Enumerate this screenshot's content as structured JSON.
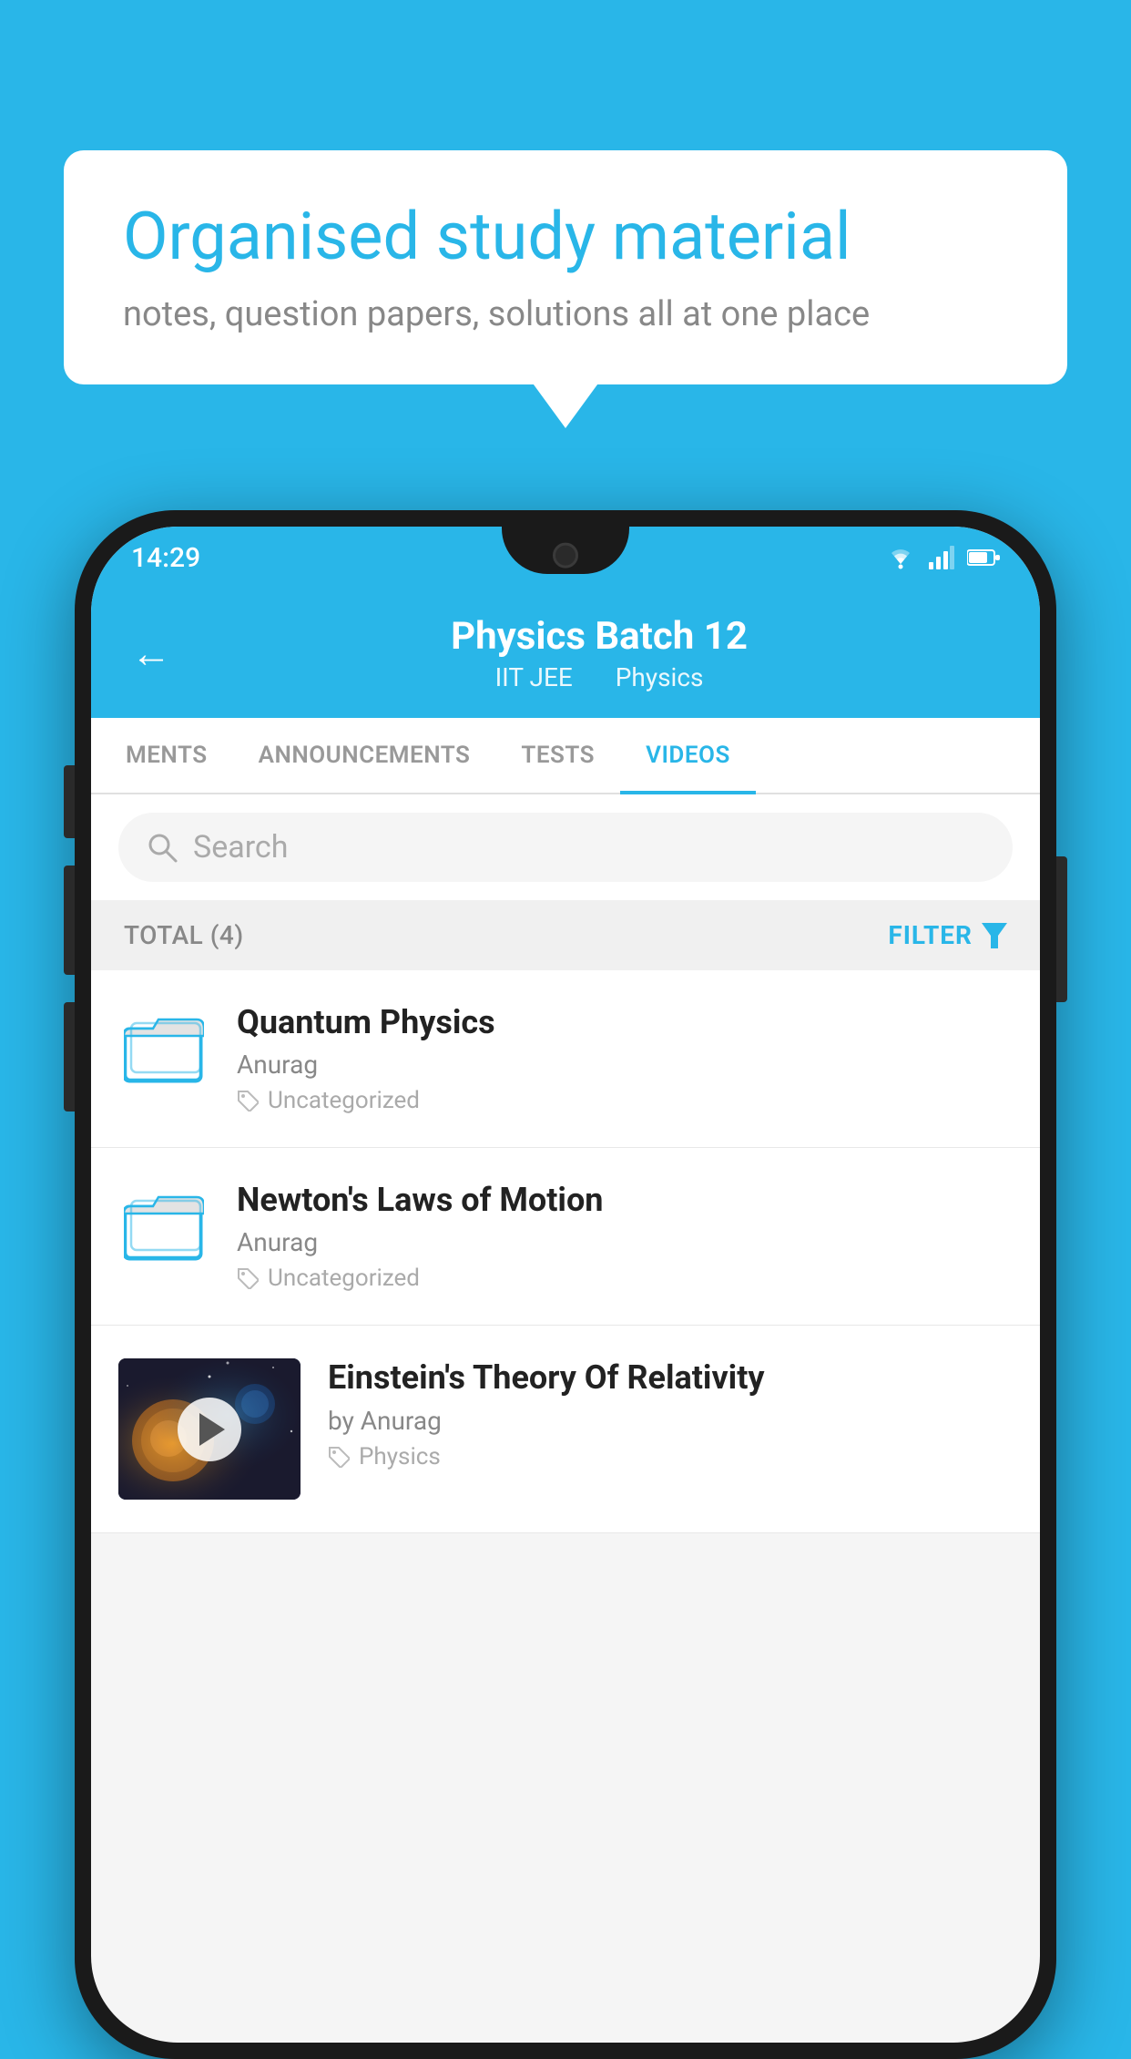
{
  "background_color": "#29b6e8",
  "speech_bubble": {
    "title": "Organised study material",
    "subtitle": "notes, question papers, solutions all at one place"
  },
  "phone": {
    "status_bar": {
      "time": "14:29",
      "icons": [
        "wifi",
        "signal",
        "battery"
      ]
    },
    "header": {
      "back_label": "←",
      "title": "Physics Batch 12",
      "subtitle_part1": "IIT JEE",
      "subtitle_part2": "Physics"
    },
    "tabs": [
      {
        "label": "MENTS",
        "active": false
      },
      {
        "label": "ANNOUNCEMENTS",
        "active": false
      },
      {
        "label": "TESTS",
        "active": false
      },
      {
        "label": "VIDEOS",
        "active": true
      }
    ],
    "search": {
      "placeholder": "Search"
    },
    "filter_bar": {
      "total_label": "TOTAL (4)",
      "filter_label": "FILTER"
    },
    "video_items": [
      {
        "title": "Quantum Physics",
        "author": "Anurag",
        "tag": "Uncategorized",
        "type": "folder"
      },
      {
        "title": "Newton's Laws of Motion",
        "author": "Anurag",
        "tag": "Uncategorized",
        "type": "folder"
      },
      {
        "title": "Einstein's Theory Of Relativity",
        "author": "by Anurag",
        "tag": "Physics",
        "type": "video"
      }
    ]
  }
}
